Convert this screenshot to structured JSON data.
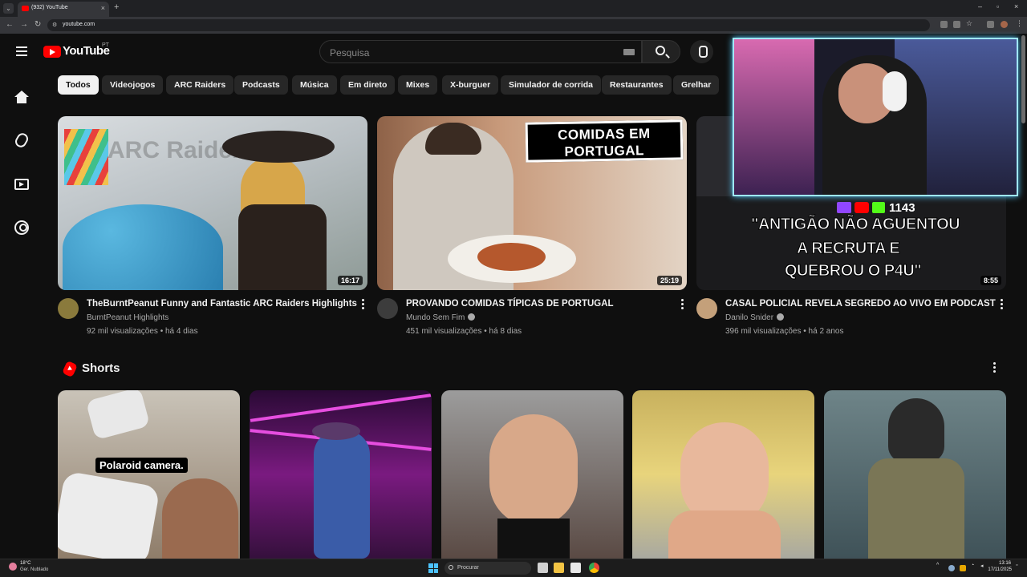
{
  "browser": {
    "tab_title": "(932) YouTube",
    "url": "youtube.com"
  },
  "header": {
    "logo_text": "YouTube",
    "country_code": "PT",
    "search_placeholder": "Pesquisa"
  },
  "chips": [
    "Todos",
    "Videojogos",
    "ARC Raiders",
    "Podcasts",
    "Música",
    "Em direto",
    "Mixes",
    "X-burguer",
    "Simulador de corrida",
    "Restaurantes",
    "Grelhar"
  ],
  "videos": [
    {
      "title": "TheBurntPeanut Funny and Fantastic ARC Raiders Highlights",
      "channel": "BurntPeanut Highlights",
      "meta": "92 mil visualizações • há 4 dias",
      "duration": "16:17",
      "verified": false
    },
    {
      "title": "PROVANDO COMIDAS TÍPICAS DE PORTUGAL",
      "channel": "Mundo Sem Fim",
      "meta": "451 mil visualizações • há 8 dias",
      "duration": "25:19",
      "verified": true
    },
    {
      "title": "CASAL POLICIAL REVELA SEGREDO AO VIVO EM PODCAST",
      "channel": "Danilo Snider",
      "meta": "396 mil visualizações • há 2 anos",
      "duration": "8:55",
      "verified": true
    }
  ],
  "thumb_text": {
    "v1_logo": "ARC Raiders",
    "v2_banner_1": "COMIDAS EM",
    "v2_banner_2": "PORTUGAL",
    "v3_count": "1143",
    "v3_line_1": "\"ANTIGÃO NÃO AGUENTOU",
    "v3_line_2": "A RECRUTA E",
    "v3_line_3": "QUEBROU O P4U\""
  },
  "shorts": {
    "title": "Shorts",
    "items": [
      {
        "caption": "Polaroid camera."
      },
      {
        "caption": ""
      },
      {
        "caption": ""
      },
      {
        "caption": ""
      },
      {
        "caption": ""
      }
    ]
  },
  "taskbar": {
    "temperature": "18°C",
    "weather": "Ger. Nublado",
    "search": "Procurar",
    "time": "13:16",
    "date": "17/11/2025"
  },
  "colors": {
    "background": "#0f0f0f",
    "chip": "#272727",
    "chip_active": "#f1f1f1",
    "brand_red": "#ff0000"
  }
}
